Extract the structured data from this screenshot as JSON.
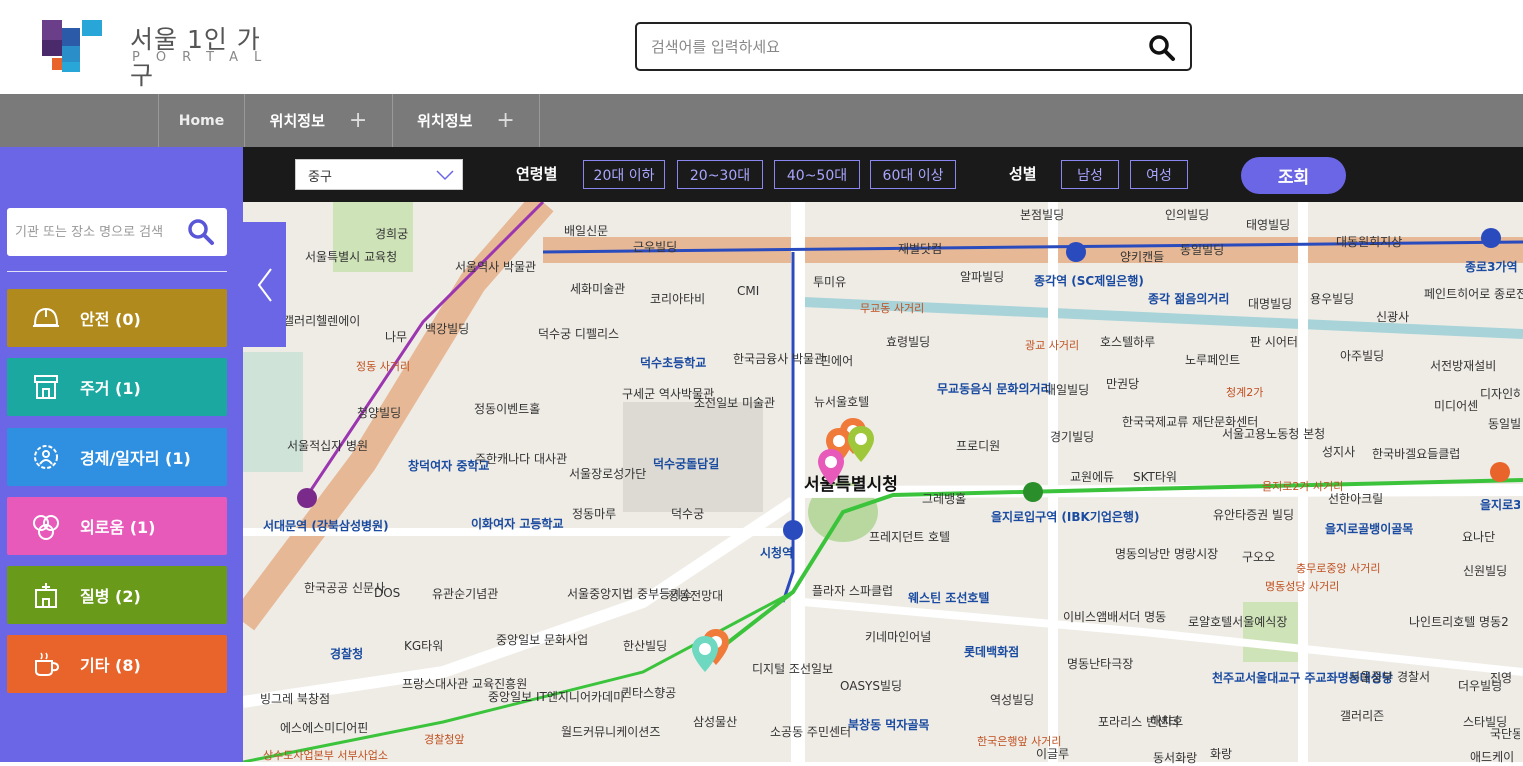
{
  "header": {
    "logo_title": "서울 1인 가구",
    "logo_sub": "PORTAL",
    "search_placeholder": "검색어를 입력하세요"
  },
  "nav": {
    "home": "Home",
    "menu1": "위치정보",
    "menu2": "위치정보",
    "plus": "+"
  },
  "sidebar": {
    "search_placeholder": "기관 또는 장소 명으로 검색",
    "categories": [
      {
        "label": "안전 (0)",
        "color": "#b08a1c",
        "icon": "helmet-icon"
      },
      {
        "label": "주거 (1)",
        "color": "#1aa8a0",
        "icon": "house-icon"
      },
      {
        "label": "경제/일자리 (1)",
        "color": "#2f8fe0",
        "icon": "gear-people-icon"
      },
      {
        "label": "외로움 (1)",
        "color": "#e85aba",
        "icon": "faces-icon"
      },
      {
        "label": "질병 (2)",
        "color": "#6a9a1a",
        "icon": "hospital-icon"
      },
      {
        "label": "기타 (8)",
        "color": "#e8642a",
        "icon": "coffee-icon"
      }
    ]
  },
  "toolbar": {
    "district": "중구",
    "age_label": "연령별",
    "ages": [
      "20대 이하",
      "20~30대",
      "40~50대",
      "60대 이상"
    ],
    "gender_label": "성별",
    "genders": [
      "남성",
      "여성"
    ],
    "submit": "조회"
  },
  "map": {
    "labels": [
      {
        "text": "경희궁",
        "type": "normal"
      },
      {
        "text": "서울특별시 교육청",
        "type": "normal"
      },
      {
        "text": "서울역사 박물관",
        "type": "normal"
      },
      {
        "text": "세화미술관",
        "type": "normal"
      },
      {
        "text": "코리아타비",
        "type": "normal"
      },
      {
        "text": "CMI",
        "type": "normal"
      },
      {
        "text": "근우빌딩",
        "type": "normal"
      },
      {
        "text": "배일신문",
        "type": "normal"
      },
      {
        "text": "투미유",
        "type": "normal"
      },
      {
        "text": "재벌닷컴",
        "type": "normal"
      },
      {
        "text": "알파빌딩",
        "type": "normal"
      },
      {
        "text": "본점빌딩",
        "type": "normal"
      },
      {
        "text": "인의빌딩",
        "type": "normal"
      },
      {
        "text": "태영빌딩",
        "type": "normal"
      },
      {
        "text": "대동원회지상",
        "type": "normal"
      },
      {
        "text": "양키캔들",
        "type": "normal"
      },
      {
        "text": "동일빌딩",
        "type": "normal"
      },
      {
        "text": "종각역 (SC제일은행)",
        "type": "blue"
      },
      {
        "text": "종각 젊음의거리",
        "type": "blue"
      },
      {
        "text": "대명빌딩",
        "type": "normal"
      },
      {
        "text": "용우빌딩",
        "type": "normal"
      },
      {
        "text": "신광사",
        "type": "normal"
      },
      {
        "text": "페인트히어로 종로전용관",
        "type": "normal"
      },
      {
        "text": "종로3가역",
        "type": "blue"
      },
      {
        "text": "갤러리헬렌에이",
        "type": "normal"
      },
      {
        "text": "나무",
        "type": "normal"
      },
      {
        "text": "백강빌딩",
        "type": "normal"
      },
      {
        "text": "덕수궁 디펠리스",
        "type": "normal"
      },
      {
        "text": "덕수초등학교",
        "type": "blue"
      },
      {
        "text": "한국금융사 박물관",
        "type": "normal"
      },
      {
        "text": "핀에어",
        "type": "normal"
      },
      {
        "text": "무교동 사거리",
        "type": "sm"
      },
      {
        "text": "효령빌딩",
        "type": "normal"
      },
      {
        "text": "호스텔하루",
        "type": "normal"
      },
      {
        "text": "광교 사거리",
        "type": "sm"
      },
      {
        "text": "노루페인트",
        "type": "normal"
      },
      {
        "text": "판 시어터",
        "type": "normal"
      },
      {
        "text": "아주빌딩",
        "type": "normal"
      },
      {
        "text": "서전방재설비",
        "type": "normal"
      },
      {
        "text": "구세군 역사박물관",
        "type": "normal"
      },
      {
        "text": "조선일보 미술관",
        "type": "normal"
      },
      {
        "text": "뉴서울호텔",
        "type": "normal"
      },
      {
        "text": "무교동음식 문화의거리",
        "type": "blue"
      },
      {
        "text": "대일빌딩",
        "type": "normal"
      },
      {
        "text": "만권당",
        "type": "normal"
      },
      {
        "text": "디자인하우스",
        "type": "normal"
      },
      {
        "text": "미디어센",
        "type": "normal"
      },
      {
        "text": "청양빌딩",
        "type": "normal"
      },
      {
        "text": "정동이벤트홀",
        "type": "normal"
      },
      {
        "text": "한국국제교류 재단문화센터",
        "type": "normal"
      },
      {
        "text": "서울고용노동청 본청",
        "type": "normal"
      },
      {
        "text": "경기빌딩",
        "type": "normal"
      },
      {
        "text": "프로디원",
        "type": "normal"
      },
      {
        "text": "동일빌딩",
        "type": "normal"
      },
      {
        "text": "성지사",
        "type": "normal"
      },
      {
        "text": "한국바겔요들클럽",
        "type": "normal"
      },
      {
        "text": "서울적십자 병원",
        "type": "normal"
      },
      {
        "text": "창덕여자 중학교",
        "type": "blue"
      },
      {
        "text": "주한캐나다 대사관",
        "type": "normal"
      },
      {
        "text": "서울장로성가단",
        "type": "normal"
      },
      {
        "text": "덕수궁돌담길",
        "type": "blue"
      },
      {
        "text": "서울특별시청",
        "type": "big"
      },
      {
        "text": "그레뱅홀",
        "type": "normal"
      },
      {
        "text": "교원에듀",
        "type": "normal"
      },
      {
        "text": "SKT타워",
        "type": "normal"
      },
      {
        "text": "을지로2가 사거리",
        "type": "sm"
      },
      {
        "text": "선한아크릴",
        "type": "normal"
      },
      {
        "text": "을지로3가",
        "type": "blue"
      },
      {
        "text": "서대문역 (강북삼성병원)",
        "type": "blue"
      },
      {
        "text": "이화여자 고등학교",
        "type": "blue"
      },
      {
        "text": "정동마루",
        "type": "normal"
      },
      {
        "text": "덕수궁",
        "type": "normal"
      },
      {
        "text": "시청역",
        "type": "blue"
      },
      {
        "text": "프레지던트 호텔",
        "type": "normal"
      },
      {
        "text": "을지로입구역 (IBK기업은행)",
        "type": "blue"
      },
      {
        "text": "유안타증권 빌딩",
        "type": "normal"
      },
      {
        "text": "을지로골뱅이골목",
        "type": "blue"
      },
      {
        "text": "요나단",
        "type": "normal"
      },
      {
        "text": "한국공공 신문사",
        "type": "normal"
      },
      {
        "text": "DOS",
        "type": "normal"
      },
      {
        "text": "유관순기념관",
        "type": "normal"
      },
      {
        "text": "서울중앙지법 중부등기소",
        "type": "normal"
      },
      {
        "text": "정동전망대",
        "type": "normal"
      },
      {
        "text": "플라자 스파클럽",
        "type": "normal"
      },
      {
        "text": "웨스틴 조선호텔",
        "type": "blue"
      },
      {
        "text": "명동의낭만 명랑시장",
        "type": "normal"
      },
      {
        "text": "구오오",
        "type": "normal"
      },
      {
        "text": "명동성당 사거리",
        "type": "sm"
      },
      {
        "text": "충무로중앙 사거리",
        "type": "sm"
      },
      {
        "text": "신원빌딩",
        "type": "normal"
      },
      {
        "text": "중앙일보 문화사업",
        "type": "normal"
      },
      {
        "text": "KG타워",
        "type": "normal"
      },
      {
        "text": "한산빌딩",
        "type": "normal"
      },
      {
        "text": "이비스앰배서더 명동",
        "type": "normal"
      },
      {
        "text": "로얄호텔서울예식장",
        "type": "normal"
      },
      {
        "text": "나인트리호텔 명동2",
        "type": "normal"
      },
      {
        "text": "키네마인어널",
        "type": "normal"
      },
      {
        "text": "롯데백화점",
        "type": "blue"
      },
      {
        "text": "경찰청",
        "type": "blue"
      },
      {
        "text": "프랑스대사관 교육진흥원",
        "type": "normal"
      },
      {
        "text": "중앙일보 IT엔지니어카데미",
        "type": "normal"
      },
      {
        "text": "퀸타스향공",
        "type": "normal"
      },
      {
        "text": "디지털 조선일보",
        "type": "normal"
      },
      {
        "text": "OASYS빌딩",
        "type": "normal"
      },
      {
        "text": "명동난타극장",
        "type": "normal"
      },
      {
        "text": "천주교서울대교구 주교좌명동대성당",
        "type": "blue"
      },
      {
        "text": "서울중부 경찰서",
        "type": "normal"
      },
      {
        "text": "더우빌딩",
        "type": "normal"
      },
      {
        "text": "빙그레 북창점",
        "type": "normal"
      },
      {
        "text": "에스에스미디어핀",
        "type": "normal"
      },
      {
        "text": "월드커뮤니케이션즈",
        "type": "normal"
      },
      {
        "text": "삼성물산",
        "type": "normal"
      },
      {
        "text": "소공동 주민센터",
        "type": "normal"
      },
      {
        "text": "북창동 먹자골목",
        "type": "blue"
      },
      {
        "text": "역성빌딩",
        "type": "normal"
      },
      {
        "text": "포라리스 빈센터",
        "type": "normal"
      },
      {
        "text": "해치호",
        "type": "normal"
      },
      {
        "text": "갤러리즌",
        "type": "normal"
      },
      {
        "text": "스타빌딩",
        "type": "normal"
      },
      {
        "text": "이글루",
        "type": "normal"
      },
      {
        "text": "동서화랑",
        "type": "normal"
      },
      {
        "text": "화랑",
        "type": "normal"
      },
      {
        "text": "애드케이",
        "type": "normal"
      },
      {
        "text": "국단동",
        "type": "normal"
      },
      {
        "text": "진영",
        "type": "normal"
      },
      {
        "text": "경찰청앞",
        "type": "sm"
      },
      {
        "text": "상수도사업본부 서부사업소",
        "type": "sm"
      },
      {
        "text": "한국은행앞 사거리",
        "type": "sm"
      },
      {
        "text": "정동 사거리",
        "type": "sm"
      },
      {
        "text": "청계2가",
        "type": "sm"
      }
    ]
  },
  "colors": {
    "accent": "#6b66e6",
    "toolbar_bg": "#1a1a1a",
    "nav_bg": "#7a7a7a"
  }
}
